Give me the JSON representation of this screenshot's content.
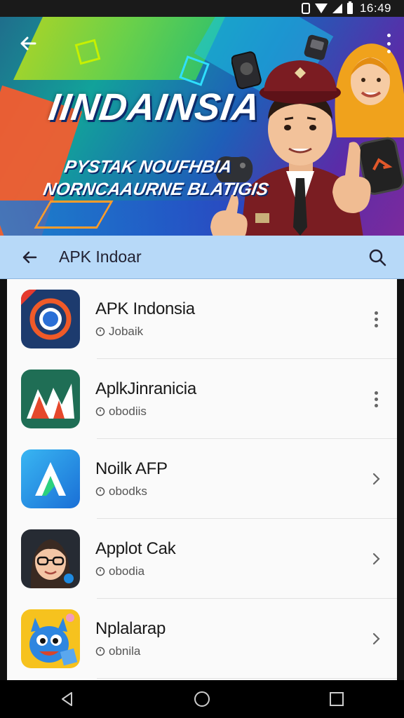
{
  "status_bar": {
    "time": "16:49",
    "icons": [
      "vibrate-icon",
      "wifi-icon",
      "signal-icon",
      "battery-icon"
    ]
  },
  "banner": {
    "title": "IINDAINSIA",
    "subtitle_line1": "PYSTAK NOUFHBIA",
    "subtitle_line2": "NORNCAAURNE BLATIGIS",
    "back_icon": "arrow-left-icon",
    "more_icon": "more-vertical-icon"
  },
  "search_header": {
    "title": "APK Indoar",
    "back_icon": "arrow-left-icon",
    "search_icon": "search-icon"
  },
  "apps": [
    {
      "title": "APK Indonsia",
      "subtitle": "Jobaik",
      "action": "more",
      "icon": "target-app-icon"
    },
    {
      "title": "AplkJinranicia",
      "subtitle": "obodiis",
      "action": "more",
      "icon": "mountain-app-icon"
    },
    {
      "title": "Noilk AFP",
      "subtitle": "obodks",
      "action": "chevron",
      "icon": "letter-a-app-icon"
    },
    {
      "title": "Applot Cak",
      "subtitle": "obodia",
      "action": "chevron",
      "icon": "glasses-face-app-icon"
    },
    {
      "title": "Nplalarap",
      "subtitle": "obnila",
      "action": "chevron",
      "icon": "monster-app-icon"
    }
  ],
  "nav_bar": {
    "back": "back-triangle-icon",
    "home": "home-circle-icon",
    "recents": "recents-square-icon"
  }
}
